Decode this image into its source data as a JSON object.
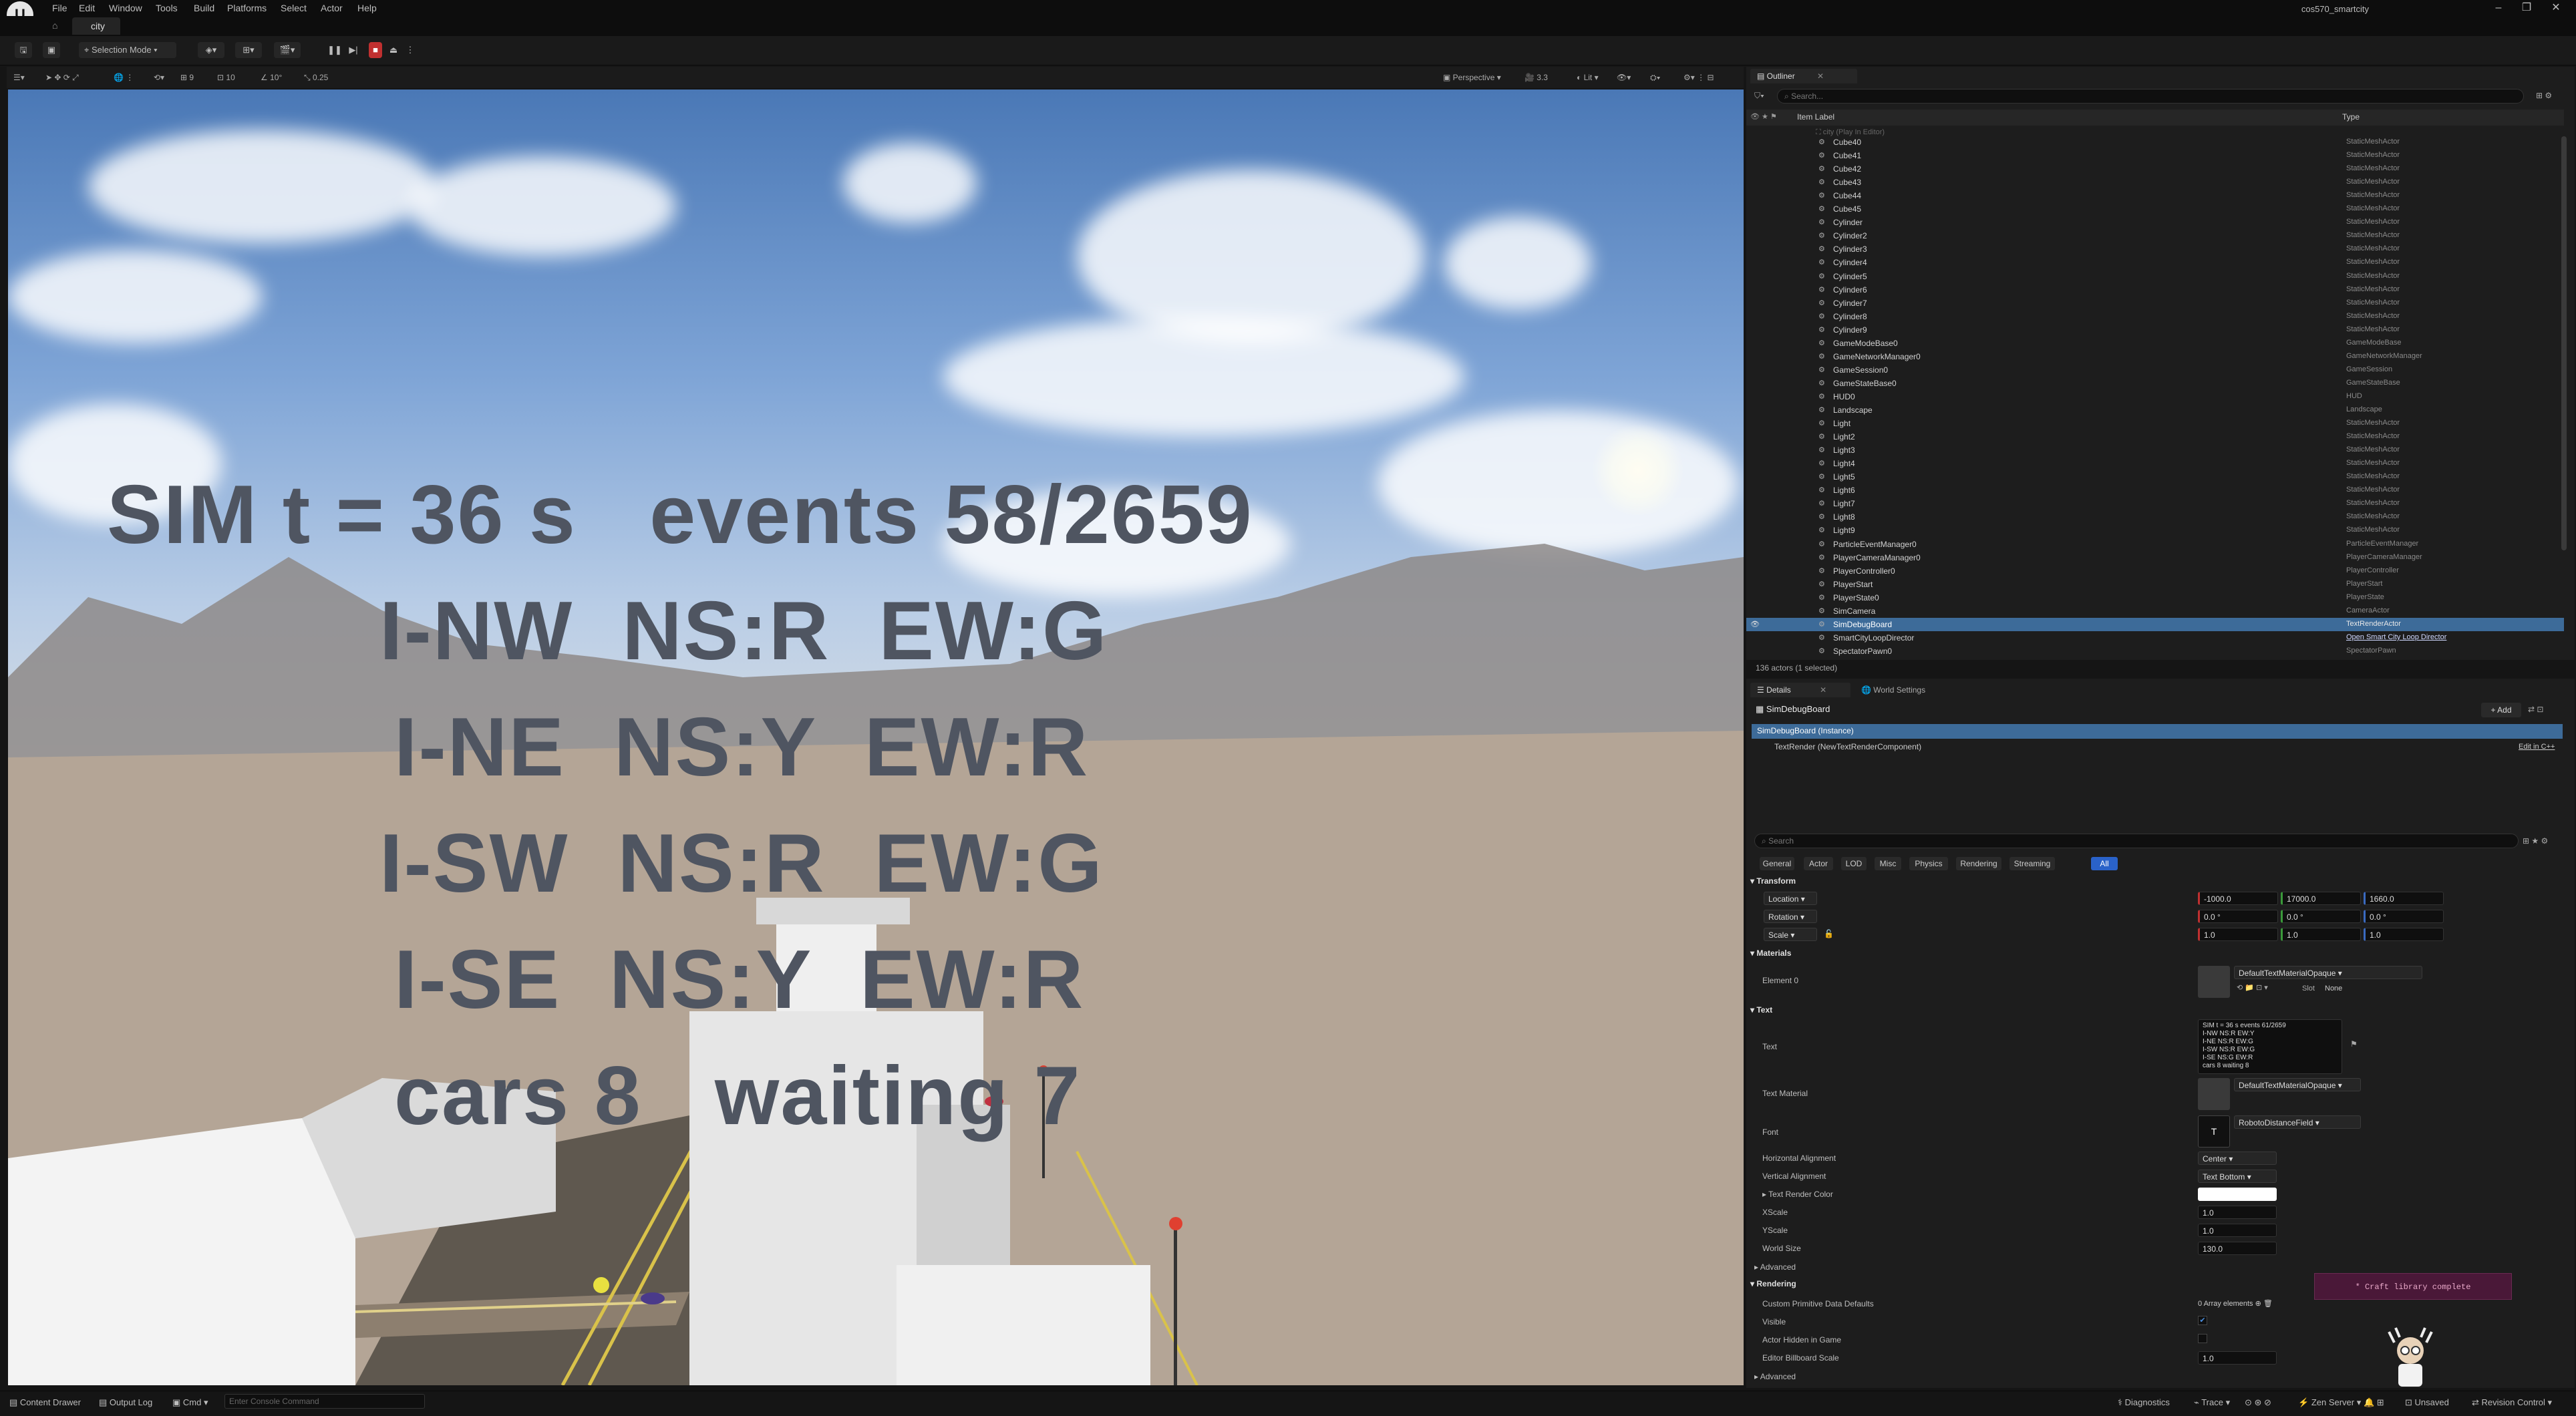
{
  "menu": {
    "items": [
      "File",
      "Edit",
      "Window",
      "Tools",
      "Build",
      "Platforms",
      "Select",
      "Actor",
      "Help"
    ],
    "project": "cos570_smartcity"
  },
  "tabs": {
    "level": "city"
  },
  "toolbar": {
    "selection_mode": "Selection Mode"
  },
  "viewport_toolbar": {
    "perspective": "Perspective",
    "lit": "Lit",
    "snap_move": "10",
    "snap_rot": "10°",
    "snap_scale": "0.25",
    "cam_speed": "3.3",
    "grid_count": "9"
  },
  "sim_board": {
    "line1": "SIM t = 36 s   events 58/2659",
    "line2": "I-NW  NS:R  EW:G",
    "line3": "I-NE  NS:Y  EW:R",
    "line4": "I-SW  NS:R  EW:G",
    "line5": "I-SE  NS:Y  EW:R",
    "line6": "cars 8   waiting 7"
  },
  "outliner": {
    "tab": "Outliner",
    "search_placeholder": "Search...",
    "col_label": "Item Label",
    "col_type": "Type",
    "root": "city (Play In Editor)",
    "rows": [
      {
        "name": "Cube40",
        "type": "StaticMeshActor"
      },
      {
        "name": "Cube41",
        "type": "StaticMeshActor"
      },
      {
        "name": "Cube42",
        "type": "StaticMeshActor"
      },
      {
        "name": "Cube43",
        "type": "StaticMeshActor"
      },
      {
        "name": "Cube44",
        "type": "StaticMeshActor"
      },
      {
        "name": "Cube45",
        "type": "StaticMeshActor"
      },
      {
        "name": "Cylinder",
        "type": "StaticMeshActor"
      },
      {
        "name": "Cylinder2",
        "type": "StaticMeshActor"
      },
      {
        "name": "Cylinder3",
        "type": "StaticMeshActor"
      },
      {
        "name": "Cylinder4",
        "type": "StaticMeshActor"
      },
      {
        "name": "Cylinder5",
        "type": "StaticMeshActor"
      },
      {
        "name": "Cylinder6",
        "type": "StaticMeshActor"
      },
      {
        "name": "Cylinder7",
        "type": "StaticMeshActor"
      },
      {
        "name": "Cylinder8",
        "type": "StaticMeshActor"
      },
      {
        "name": "Cylinder9",
        "type": "StaticMeshActor"
      },
      {
        "name": "GameModeBase0",
        "type": "GameModeBase"
      },
      {
        "name": "GameNetworkManager0",
        "type": "GameNetworkManager"
      },
      {
        "name": "GameSession0",
        "type": "GameSession"
      },
      {
        "name": "GameStateBase0",
        "type": "GameStateBase"
      },
      {
        "name": "HUD0",
        "type": "HUD"
      },
      {
        "name": "Landscape",
        "type": "Landscape"
      },
      {
        "name": "Light",
        "type": "StaticMeshActor"
      },
      {
        "name": "Light2",
        "type": "StaticMeshActor"
      },
      {
        "name": "Light3",
        "type": "StaticMeshActor"
      },
      {
        "name": "Light4",
        "type": "StaticMeshActor"
      },
      {
        "name": "Light5",
        "type": "StaticMeshActor"
      },
      {
        "name": "Light6",
        "type": "StaticMeshActor"
      },
      {
        "name": "Light7",
        "type": "StaticMeshActor"
      },
      {
        "name": "Light8",
        "type": "StaticMeshActor"
      },
      {
        "name": "Light9",
        "type": "StaticMeshActor"
      },
      {
        "name": "ParticleEventManager0",
        "type": "ParticleEventManager"
      },
      {
        "name": "PlayerCameraManager0",
        "type": "PlayerCameraManager"
      },
      {
        "name": "PlayerController0",
        "type": "PlayerController"
      },
      {
        "name": "PlayerStart",
        "type": "PlayerStart"
      },
      {
        "name": "PlayerState0",
        "type": "PlayerState"
      },
      {
        "name": "SimCamera",
        "type": "CameraActor"
      },
      {
        "name": "SimDebugBoard",
        "type": "TextRenderActor"
      },
      {
        "name": "SmartCityLoopDirector",
        "type": "Open Smart City Loop Director"
      },
      {
        "name": "SpectatorPawn0",
        "type": "SpectatorPawn"
      }
    ],
    "count": "136 actors (1 selected)"
  },
  "details": {
    "tab": "Details",
    "tab2": "World Settings",
    "actor": "SimDebugBoard",
    "add": "+ Add",
    "instance": "SimDebugBoard (Instance)",
    "component": "TextRender (NewTextRenderComponent)",
    "edit_cpp": "Edit in C++",
    "search_placeholder": "Search",
    "filters": [
      "General",
      "Actor",
      "LOD",
      "Misc",
      "Physics",
      "Rendering",
      "Streaming",
      "All"
    ],
    "transform": {
      "section": "Transform",
      "location": "Location",
      "rotation": "Rotation",
      "scale": "Scale",
      "loc": [
        "-1000.0",
        "17000.0",
        "1660.0"
      ],
      "rot": [
        "0.0 °",
        "0.0 °",
        "0.0 °"
      ],
      "scl": [
        "1.0",
        "1.0",
        "1.0"
      ]
    },
    "materials": {
      "section": "Materials",
      "element": "Element 0",
      "material": "DefaultTextMaterialOpaque",
      "slot": "Slot",
      "slot_value": "None"
    },
    "text": {
      "section": "Text",
      "label": "Text",
      "value_lines": [
        "SIM t = 36 s   events 61/2659",
        "I-NW  NS:R  EW:Y",
        "I-NE  NS:R  EW:G",
        "I-SW  NS:R  EW:G",
        "I-SE  NS:G  EW:R",
        "cars 8   waiting 8"
      ],
      "text_material": "Text Material",
      "text_material_value": "DefaultTextMaterialOpaque",
      "font": "Font",
      "font_value": "RobotoDistanceField",
      "halign": "Horizontal Alignment",
      "halign_value": "Center",
      "valign": "Vertical Alignment",
      "valign_value": "Text Bottom",
      "color": "Text Render Color",
      "xscale": "XScale",
      "xscale_value": "1.0",
      "yscale": "YScale",
      "yscale_value": "1.0",
      "world_size": "World Size",
      "world_size_value": "130.0",
      "advanced": "Advanced"
    },
    "rendering": {
      "section": "Rendering",
      "cpd": "Custom Primitive Data Defaults",
      "cpd_value": "0 Array elements",
      "visible": "Visible",
      "hidden": "Actor Hidden in Game",
      "billboard": "Editor Billboard Scale",
      "billboard_value": "1.0",
      "advanced": "Advanced"
    }
  },
  "toast": "* Craft library complete",
  "bottom": {
    "content_drawer": "Content Drawer",
    "output_log": "Output Log",
    "cmd": "Cmd",
    "console_placeholder": "Enter Console Command",
    "diagnostics": "Diagnostics",
    "trace": "Trace",
    "zen": "Zen Server",
    "unsaved": "Unsaved",
    "revision": "Revision Control"
  },
  "colors": {
    "selection": "#3d6b99",
    "accent": "#2a62c9",
    "sim_text": "#4f5561"
  }
}
